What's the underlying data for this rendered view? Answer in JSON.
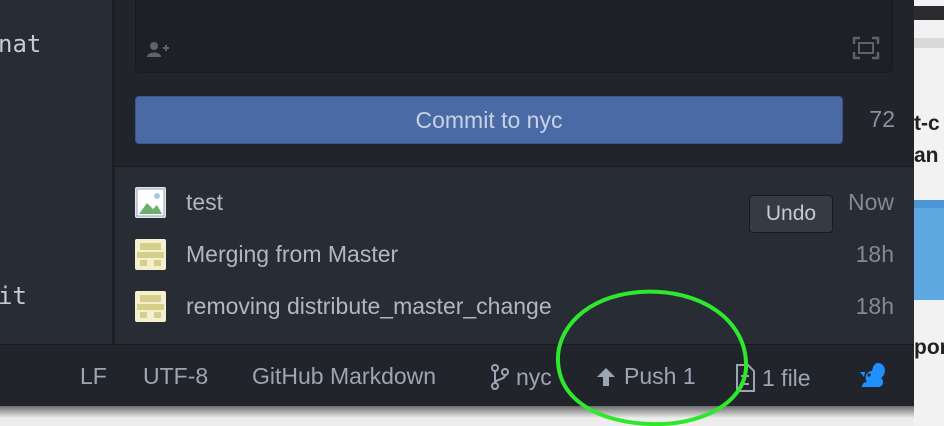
{
  "editor": {
    "line_a": "nat",
    "line_b": "it"
  },
  "git_panel": {
    "coauthor_icon": "add-user-icon",
    "expand_icon": "expand-icon",
    "commit_button_label": "Commit to nyc",
    "char_count": "72",
    "undo_label": "Undo",
    "commits": [
      {
        "message": "test",
        "time": "Now",
        "avatar": "image-placeholder"
      },
      {
        "message": "Merging from Master",
        "time": "18h",
        "avatar": "identicon"
      },
      {
        "message": "removing distribute_master_change",
        "time": "18h",
        "avatar": "identicon"
      }
    ]
  },
  "status_bar": {
    "line_ending": "LF",
    "encoding": "UTF-8",
    "grammar": "GitHub Markdown",
    "branch": "nyc",
    "push_label": "Push 1",
    "changed_files": "1 file",
    "branch_icon": "git-branch-icon",
    "push_icon": "arrow-up-icon",
    "file_icon": "file-diff-icon",
    "github_icon": "squirrel-icon"
  },
  "background_window": {
    "text_a": "t-c",
    "text_b": "an",
    "text_c": "por"
  },
  "colors": {
    "commit_button": "#4a6aa5",
    "annotation_circle": "#2ee82e",
    "squirrel": "#1e90ff"
  }
}
